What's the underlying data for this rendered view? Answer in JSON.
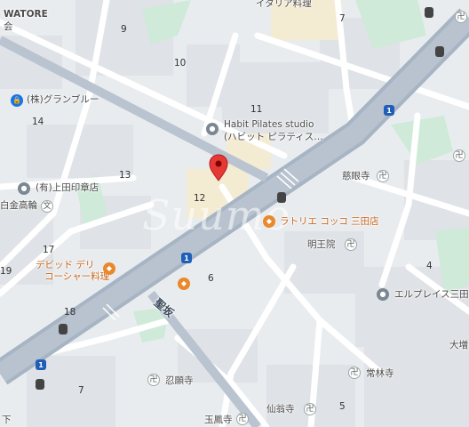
{
  "map": {
    "road_label": "聖坂",
    "watermark": "Suumo"
  },
  "labels": {
    "watore": "WATORE",
    "watore_sub": "会",
    "italia": "イタリア料理",
    "grandblue": "(株)グランブルー",
    "habit_line1": "Habit Pilates studio",
    "habit_line2": "(ハビット ピラティス…",
    "ueda": "(有)上田印章店",
    "shirokane": "白金高輪",
    "devid_line1": "デビッド デリ",
    "devid_line2": "コーシャー料理",
    "trattoria": "ラトリエ コッコ 三田店",
    "jigenji": "慈眼寺",
    "myooin": "明王院",
    "elplace": "エルプレイス三田",
    "ninganji": "忍願寺",
    "jorinji": "常林寺",
    "sensoji": "仙翁寺",
    "gyokuhoji": "玉鳳寺",
    "osaka": "大増",
    "shita": "下"
  },
  "numbers": {
    "n9": "9",
    "n10": "10",
    "n11": "11",
    "n7a": "7",
    "n14": "14",
    "n13": "13",
    "n12": "12",
    "n17": "17",
    "n19": "19",
    "n18": "18",
    "n6": "6",
    "n4": "4",
    "n7b": "7",
    "n5": "5"
  },
  "routes": {
    "r1": "1",
    "r2": "1",
    "r3": "1"
  },
  "icons": {
    "pin": "map-pin-icon",
    "lock": "lock-icon",
    "temple": "temple-icon",
    "restaurant": "restaurant-icon",
    "school": "school-icon",
    "bus": "bus-stop-icon"
  },
  "colors": {
    "main_road": "#a7b4c3",
    "minor_road": "#ffffff",
    "block": "#dfe2e6",
    "park": "#cfead8",
    "yellow_block": "#f4ebd3",
    "pin": "#e53935"
  }
}
